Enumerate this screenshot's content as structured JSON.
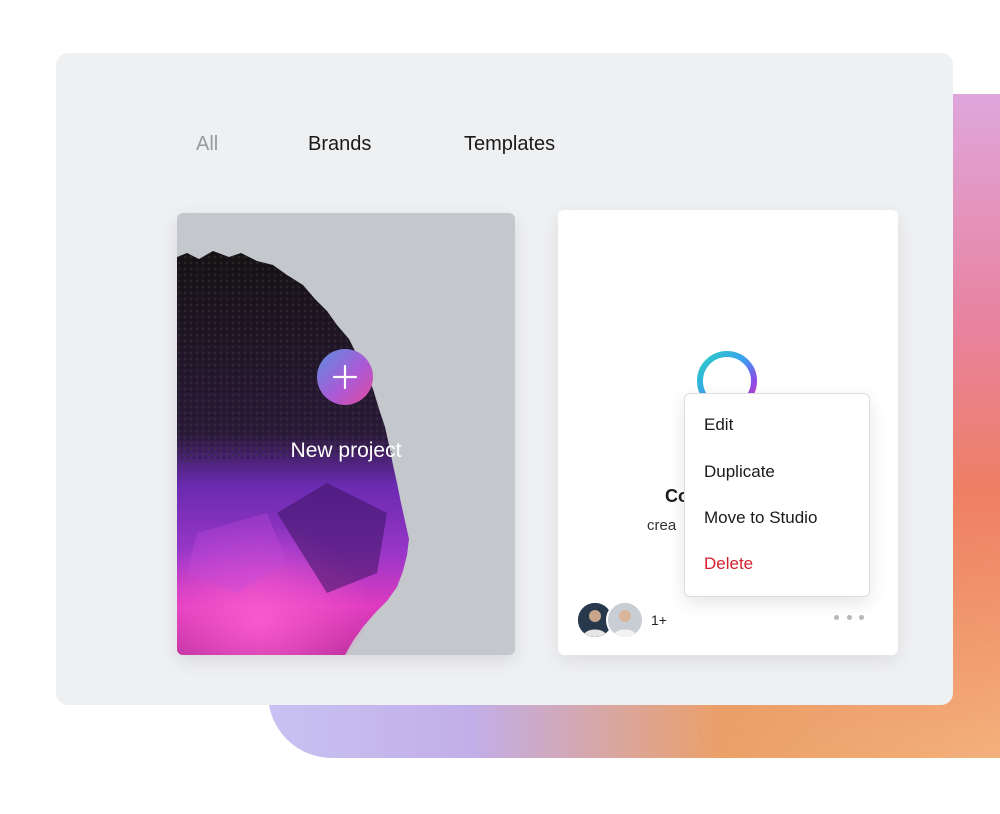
{
  "tabs": [
    {
      "label": "All"
    },
    {
      "label": "Brands"
    },
    {
      "label": "Templates"
    }
  ],
  "new_project": {
    "label": "New project",
    "icon": "plus-icon"
  },
  "project_card": {
    "title": "Co",
    "subtitle": "crea",
    "collaborators_extra": "1+",
    "more_icon": "ellipsis-icon"
  },
  "context_menu": {
    "items": [
      {
        "label": "Edit"
      },
      {
        "label": "Duplicate"
      },
      {
        "label": "Move to Studio"
      },
      {
        "label": "Delete"
      }
    ],
    "danger_color": "#d4202d"
  },
  "colors": {
    "panel": "#eff0f2",
    "accent_gradient": [
      "#5b8fe0",
      "#a95ad6",
      "#e14aa0"
    ]
  }
}
